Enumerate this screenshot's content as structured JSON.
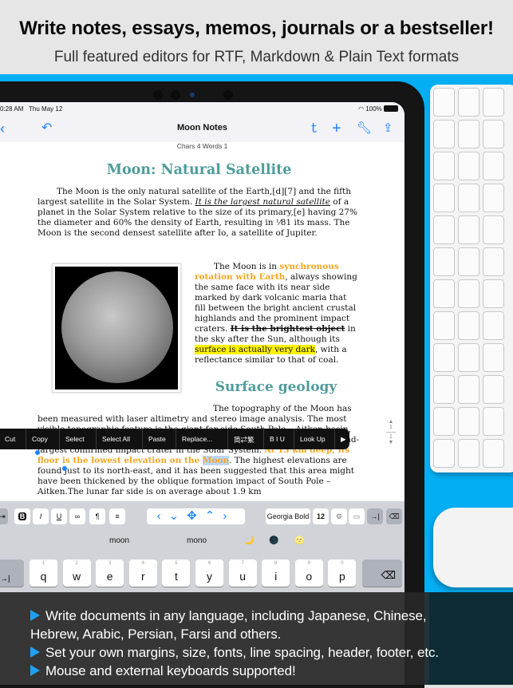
{
  "hero": {
    "headline": "Write notes, essays, memos, journals or a bestseller!",
    "subheadline": "Full featured editors for RTF, Markdown & Plain Text formats"
  },
  "status_bar": {
    "time": "0:28 AM",
    "date": "Thu May 12",
    "battery": "100%"
  },
  "nav": {
    "title": "Moon Notes",
    "icons": [
      "back-chevron-icon",
      "undo-icon",
      "tumblr-icon",
      "plus-icon",
      "wrench-icon",
      "share-icon"
    ]
  },
  "counter": "Chars 4 Words 1",
  "doc": {
    "title": "Moon: Natural Satellite",
    "p1_a": "The Moon is the only natural satellite of the Earth,[d][7] and the fifth largest satellite in the Solar System. ",
    "p1_link": "It is the largest natural satellite",
    "p1_b": " of a planet in the Solar System relative to the size of its primary,[e] having 27% the diameter and 60% the density of Earth, resulting in ¹⁄81 its mass. The Moon is the second densest satellite after Io, a satellite of Jupiter.",
    "p2_a": "The Moon is in ",
    "p2_orange": "synchronous rotation with Earth",
    "p2_b": ", always showing the same face with its near side marked by dark volcanic maria that fill between the bright ancient crustal highlands and the prominent impact craters. ",
    "p2_strike": "It is the brightest object",
    "p2_c": " in the sky after the Sun, although its ",
    "p2_hl": "surface is actually very dark",
    "p2_d": ", with a reflectance similar to that of coal.",
    "heading2": "Surface geology",
    "p3_a": "The topography of the Moon has been measured with laser altimetry and stereo image analysis. The most visible topographic feature is the giant far-side South Pole – Aitken basin, some 2,240 km in diameter, the largest crater on the Moon and the second-largest confirmed impact crater in the Solar System. ",
    "p3_orange": "At 13 km deep, its floor is the lowest elevation on the ",
    "p3_sel": "Moon",
    "p3_b": ". The highest elevations are found just to its north-east, and it has been suggested that this area might have been thickened by the oblique formation impact of South Pole – Aitken.The lunar far side is on average about 1.9 km"
  },
  "context_menu": [
    "Cut",
    "Copy",
    "Select",
    "Select All",
    "Paste",
    "Replace...",
    "简⇄繁",
    "B I U",
    "Look Up",
    "▶"
  ],
  "pager": {
    "current": "1",
    "total": "1"
  },
  "toolbar": {
    "font": "Georgia Bold",
    "size": "12",
    "buttons": [
      "B",
      "I",
      "U",
      "∞",
      "¶",
      "≡"
    ]
  },
  "suggestions": [
    "moon",
    "mono",
    "🌙",
    "🌑",
    "🌝"
  ],
  "keyboard": {
    "row1": [
      {
        "n": "1",
        "l": "q"
      },
      {
        "n": "2",
        "l": "w"
      },
      {
        "n": "3",
        "l": "e"
      },
      {
        "n": "4",
        "l": "r"
      },
      {
        "n": "5",
        "l": "t"
      },
      {
        "n": "6",
        "l": "y"
      },
      {
        "n": "7",
        "l": "u"
      },
      {
        "n": "8",
        "l": "i"
      },
      {
        "n": "9",
        "l": "o"
      },
      {
        "n": "0",
        "l": "p"
      }
    ],
    "tab": "→|",
    "delete": "⌫"
  },
  "features": [
    "Write documents in any language, including Japanese, Chinese,",
    "Hebrew, Arabic, Persian, Farsi and others.",
    "Set your own margins, size, fonts, line spacing, header, footer, etc.",
    "Mouse and external keyboards supported!"
  ],
  "colors": {
    "accent": "#1a84ff",
    "heading": "#4f9c9c",
    "orange": "#f5a623",
    "highlight": "#fff200",
    "desk": "#04aef3"
  }
}
